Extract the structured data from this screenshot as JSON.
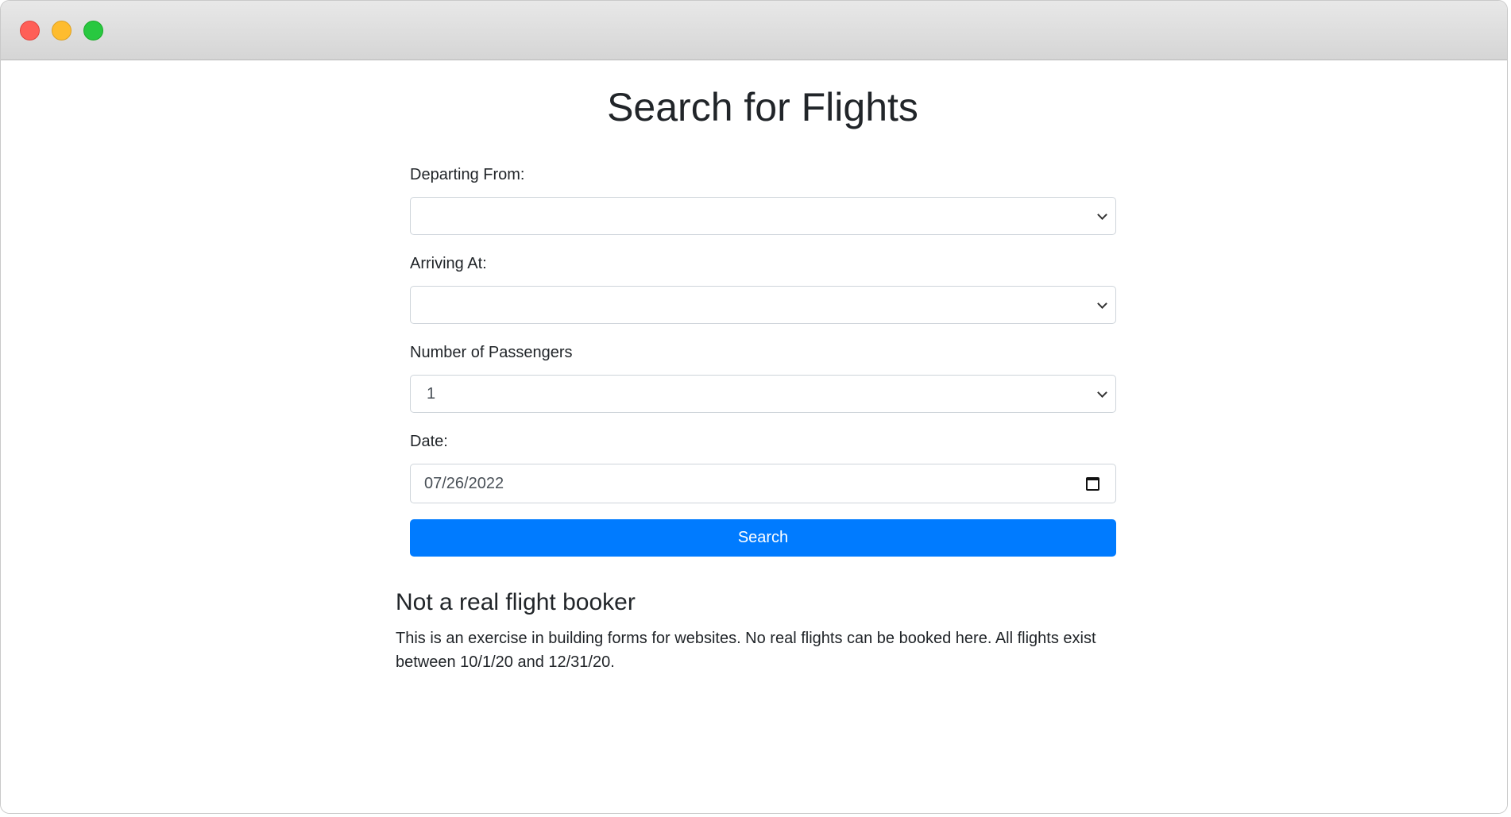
{
  "window": {
    "controls": [
      "close",
      "minimize",
      "maximize"
    ]
  },
  "page": {
    "title": "Search for Flights"
  },
  "form": {
    "departing": {
      "label": "Departing From:",
      "value": ""
    },
    "arriving": {
      "label": "Arriving At:",
      "value": ""
    },
    "passengers": {
      "label": "Number of Passengers",
      "value": "1"
    },
    "date": {
      "label": "Date:",
      "value": "07/26/2022"
    },
    "search_label": "Search"
  },
  "notice": {
    "title": "Not a real flight booker",
    "text": "This is an exercise in building forms for websites. No real flights can be booked here. All flights exist between 10/1/20 and 12/31/20."
  },
  "colors": {
    "primary": "#007bff",
    "close": "#ff5f57",
    "minimize": "#febc2e",
    "maximize": "#28c840"
  }
}
